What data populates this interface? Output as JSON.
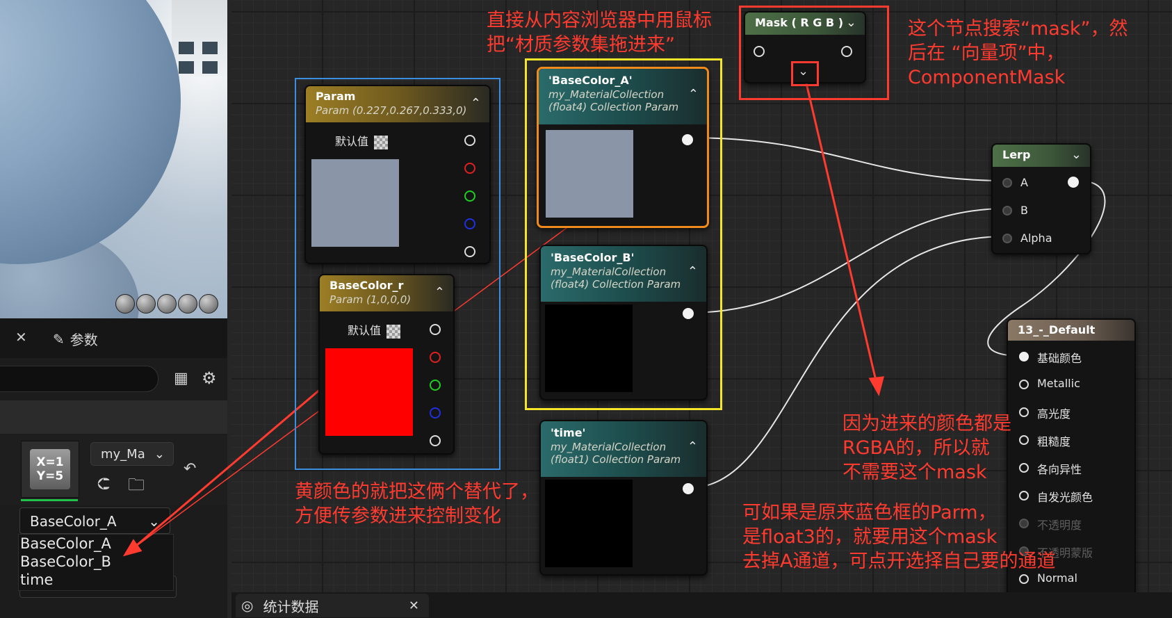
{
  "left_panel": {
    "tab_params_label": "参数",
    "asset_name": "my_Ma",
    "thumb_text": "X=1\nY=5",
    "selected_param": "BaseColor_A",
    "dropdown_options": [
      "BaseColor_A",
      "BaseColor_B",
      "time"
    ]
  },
  "bottom_bar": {
    "stats_label": "统计数据"
  },
  "nodes": {
    "param": {
      "title": "Param",
      "subtitle": "Param (0.227,0.267,0.333,0)",
      "default_label": "默认值",
      "swatch_color": "#8b95a8"
    },
    "basecolor_r": {
      "title": "BaseColor_r",
      "subtitle": "Param (1,0,0,0)",
      "default_label": "默认值",
      "swatch_color": "#ff0000"
    },
    "bc_a": {
      "title": "'BaseColor_A'",
      "sub1": "my_MaterialCollection",
      "sub2": "(float4) Collection Param",
      "swatch_color": "#8b95a8"
    },
    "bc_b": {
      "title": "'BaseColor_B'",
      "sub1": "my_MaterialCollection",
      "sub2": "(float4) Collection Param",
      "swatch_color": "#000000"
    },
    "time": {
      "title": "'time'",
      "sub1": "my_MaterialCollection",
      "sub2": "(float1) Collection Param",
      "swatch_color": "#000000"
    },
    "mask": {
      "title": "Mask ( R G B )"
    },
    "lerp": {
      "title": "Lerp",
      "pins": [
        "A",
        "B",
        "Alpha"
      ]
    },
    "default": {
      "title": "13_-_Default",
      "pins": [
        "基础颜色",
        "Metallic",
        "高光度",
        "粗糙度",
        "各向异性",
        "自发光颜色",
        "不透明度",
        "不透明蒙版",
        "Normal"
      ]
    }
  },
  "annotations": {
    "drag_from_browser": "直接从内容浏览器中用鼠标\n把“材质参数集拖进来”",
    "mask_search": "这个节点搜索“mask”，然\n后在 “向量项”中，\nComponentMask",
    "yellow_replace": "黄颜色的就把这俩个替代了，\n方便传参数进来控制变化",
    "rgba_note": "因为进来的颜色都是\nRGBA的，所以就\n不需要这个mask",
    "float3_note": "可如果是原来蓝色框的Parm，\n是float3的，就要用这个mask\n去掉A通道，可点开选择自己要的通道"
  },
  "colors": {
    "annotation_red": "#ff3b30",
    "blue_frame": "#3b8fe0",
    "yellow_frame": "#f5e62a",
    "red_frame": "#ff3b30",
    "selected_node_border": "#f08a1c"
  }
}
